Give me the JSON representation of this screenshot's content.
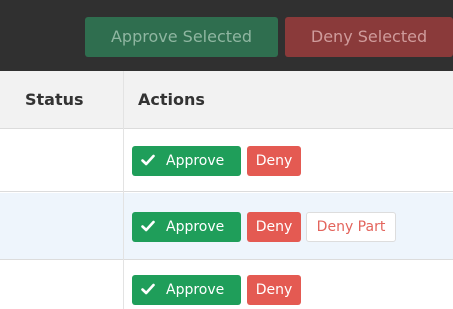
{
  "toolbar": {
    "approve_selected_label": "Approve Selected",
    "deny_selected_label": "Deny Selected"
  },
  "table": {
    "columns": [
      "Status",
      "Actions"
    ],
    "rows": [
      {
        "status": "",
        "actions": {
          "approve": "Approve",
          "deny": "Deny"
        }
      },
      {
        "status": "",
        "actions": {
          "approve": "Approve",
          "deny": "Deny",
          "deny_part": "Deny Part"
        }
      },
      {
        "status": "",
        "actions": {
          "approve": "Approve",
          "deny": "Deny"
        }
      }
    ]
  },
  "colors": {
    "toolbar_bg": "#303030",
    "approve_green": "#1f9e5a",
    "deny_red": "#e45a52",
    "highlight_row": "#eef5fc"
  },
  "icons": {
    "approve": "check-icon"
  }
}
